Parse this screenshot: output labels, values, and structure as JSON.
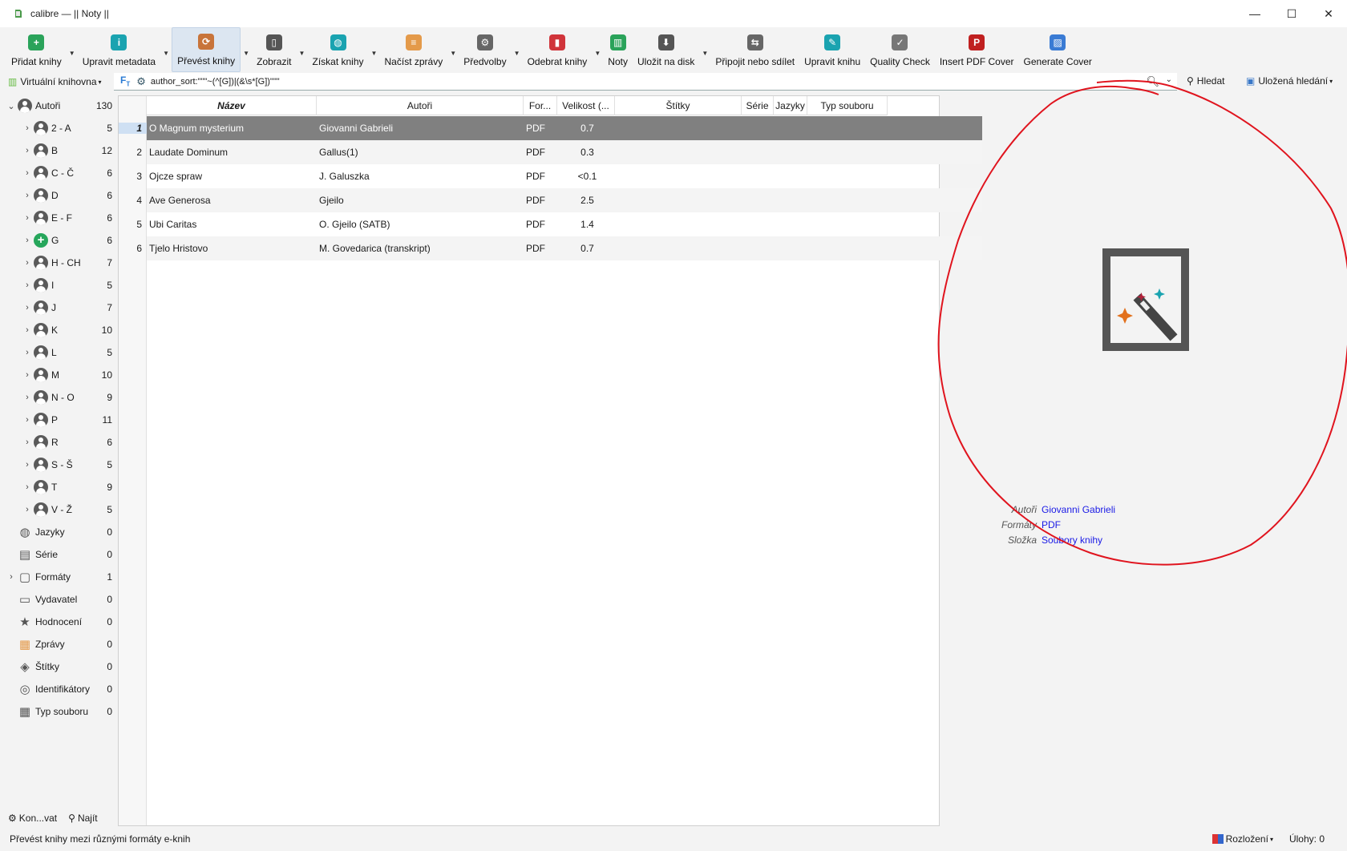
{
  "window": {
    "title": "calibre — || Noty ||",
    "minimize": "—",
    "maximize": "☐",
    "close": "✕"
  },
  "toolbar": {
    "buttons": [
      {
        "label": "Přidat knihy",
        "icon": "add-book-icon",
        "arrow": true
      },
      {
        "label": "Upravit metadata",
        "icon": "edit-metadata-icon",
        "arrow": true
      },
      {
        "label": "Převést knihy",
        "icon": "convert-icon",
        "arrow": true,
        "active": true
      },
      {
        "label": "Zobrazit",
        "icon": "view-icon",
        "arrow": true
      },
      {
        "label": "Získat knihy",
        "icon": "globe-icon",
        "arrow": true
      },
      {
        "label": "Načíst zprávy",
        "icon": "news-icon",
        "arrow": true
      },
      {
        "label": "Předvolby",
        "icon": "preferences-icon",
        "arrow": true
      },
      {
        "label": "Odebrat knihy",
        "icon": "trash-icon",
        "arrow": true
      },
      {
        "label": "Noty",
        "icon": "library-icon",
        "arrow": false
      },
      {
        "label": "Uložit na disk",
        "icon": "save-icon",
        "arrow": true
      },
      {
        "label": "Připojit nebo sdílet",
        "icon": "connect-icon",
        "arrow": false
      },
      {
        "label": "Upravit knihu",
        "icon": "edit-book-icon",
        "arrow": false
      },
      {
        "label": "Quality Check",
        "icon": "quality-check-icon",
        "arrow": false
      },
      {
        "label": "Insert PDF Cover",
        "icon": "pdf-icon",
        "arrow": false
      },
      {
        "label": "Generate Cover",
        "icon": "generate-cover-icon",
        "arrow": false
      }
    ]
  },
  "search": {
    "virtual_library": "Virtuální knihovna",
    "query": "author_sort:\"\"\"~(^[G])|(&\\s*[G])\"\"\"",
    "search_button": "Hledat",
    "saved_searches": "Uložená hledání"
  },
  "tag_browser": {
    "items": [
      {
        "label": "Autoři",
        "count": "130",
        "icon": "person",
        "expander": "open",
        "level": 0
      },
      {
        "label": "2 - A",
        "count": "5",
        "icon": "person",
        "expander": "closed",
        "level": 1
      },
      {
        "label": "B",
        "count": "12",
        "icon": "person",
        "expander": "closed",
        "level": 1
      },
      {
        "label": "C - Č",
        "count": "6",
        "icon": "person",
        "expander": "closed",
        "level": 1
      },
      {
        "label": "D",
        "count": "6",
        "icon": "person",
        "expander": "closed",
        "level": 1
      },
      {
        "label": "E - F",
        "count": "6",
        "icon": "person",
        "expander": "closed",
        "level": 1
      },
      {
        "label": "G",
        "count": "6",
        "icon": "plus",
        "expander": "closed",
        "level": 1
      },
      {
        "label": "H - CH",
        "count": "7",
        "icon": "person",
        "expander": "closed",
        "level": 1
      },
      {
        "label": "I",
        "count": "5",
        "icon": "person",
        "expander": "closed",
        "level": 1
      },
      {
        "label": "J",
        "count": "7",
        "icon": "person",
        "expander": "closed",
        "level": 1
      },
      {
        "label": "K",
        "count": "10",
        "icon": "person",
        "expander": "closed",
        "level": 1
      },
      {
        "label": "L",
        "count": "5",
        "icon": "person",
        "expander": "closed",
        "level": 1
      },
      {
        "label": "M",
        "count": "10",
        "icon": "person",
        "expander": "closed",
        "level": 1
      },
      {
        "label": "N - O",
        "count": "9",
        "icon": "person",
        "expander": "closed",
        "level": 1
      },
      {
        "label": "P",
        "count": "11",
        "icon": "person",
        "expander": "closed",
        "level": 1
      },
      {
        "label": "R",
        "count": "6",
        "icon": "person",
        "expander": "closed",
        "level": 1
      },
      {
        "label": "S - Š",
        "count": "5",
        "icon": "person",
        "expander": "closed",
        "level": 1
      },
      {
        "label": "T",
        "count": "9",
        "icon": "person",
        "expander": "closed",
        "level": 1
      },
      {
        "label": "V - Ž",
        "count": "5",
        "icon": "person",
        "expander": "closed",
        "level": 1
      },
      {
        "label": "Jazyky",
        "count": "0",
        "icon": "globe",
        "expander": "none",
        "level": 0
      },
      {
        "label": "Série",
        "count": "0",
        "icon": "series",
        "expander": "none",
        "level": 0
      },
      {
        "label": "Formáty",
        "count": "1",
        "icon": "formats",
        "expander": "closed",
        "level": 0
      },
      {
        "label": "Vydavatel",
        "count": "0",
        "icon": "publisher",
        "expander": "none",
        "level": 0
      },
      {
        "label": "Hodnocení",
        "count": "0",
        "icon": "star",
        "expander": "none",
        "level": 0
      },
      {
        "label": "Zprávy",
        "count": "0",
        "icon": "news",
        "expander": "none",
        "level": 0
      },
      {
        "label": "Štítky",
        "count": "0",
        "icon": "tag",
        "expander": "none",
        "level": 0
      },
      {
        "label": "Identifikátory",
        "count": "0",
        "icon": "identifier",
        "expander": "none",
        "level": 0
      },
      {
        "label": "Typ souboru",
        "count": "0",
        "icon": "table",
        "expander": "none",
        "level": 0
      }
    ],
    "configure": "Kon...vat",
    "find": "Najít"
  },
  "book_list": {
    "columns": [
      "Název",
      "Autoři",
      "For...",
      "Velikost (...",
      "Štítky",
      "Série",
      "Jazyky",
      "Typ souboru"
    ],
    "rows": [
      {
        "num": "1",
        "title": "O Magnum mysterium",
        "authors": "Giovanni Gabrieli",
        "format": "PDF",
        "size": "0.7"
      },
      {
        "num": "2",
        "title": "Laudate Dominum",
        "authors": "Gallus(1)",
        "format": "PDF",
        "size": "0.3"
      },
      {
        "num": "3",
        "title": "Ojcze spraw",
        "authors": "J. Galuszka",
        "format": "PDF",
        "size": "<0.1"
      },
      {
        "num": "4",
        "title": "Ave Generosa",
        "authors": "Gjeilo",
        "format": "PDF",
        "size": "2.5"
      },
      {
        "num": "5",
        "title": "Ubi Caritas",
        "authors": "O. Gjeilo (SATB)",
        "format": "PDF",
        "size": "1.4"
      },
      {
        "num": "6",
        "title": "Tjelo Hristovo",
        "authors": "M. Govedarica (transkript)",
        "format": "PDF",
        "size": "0.7"
      }
    ]
  },
  "details": {
    "authors_key": "Autoři",
    "authors_val": "Giovanni Gabrieli",
    "formats_key": "Formáty",
    "formats_val": "PDF",
    "folder_key": "Složka",
    "folder_val": "Soubory knihy"
  },
  "status": {
    "message": "Převést knihy mezi různými formáty e-knih",
    "layout": "Rozložení",
    "jobs": "Úlohy: 0"
  },
  "colors": {
    "selection": "#808080",
    "link": "#1a1ae6",
    "annotation": "#e0141e"
  }
}
